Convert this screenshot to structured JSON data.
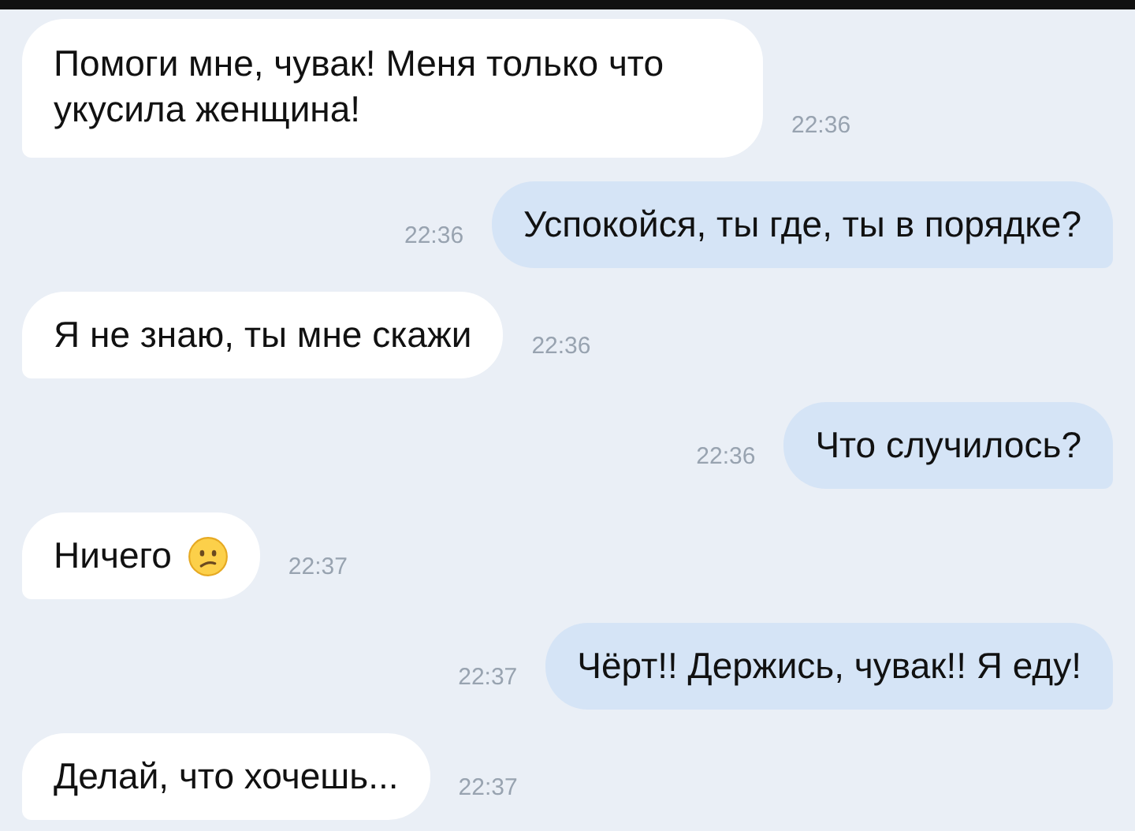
{
  "messages": [
    {
      "kind": "incoming",
      "text": "Помоги мне, чувак! Меня только что укусила женщина!",
      "time": "22:36"
    },
    {
      "kind": "outgoing",
      "text": "Успокойся, ты где, ты в порядке?",
      "time": "22:36"
    },
    {
      "kind": "incoming",
      "text": "Я не знаю, ты мне скажи",
      "time": "22:36"
    },
    {
      "kind": "outgoing",
      "text": "Что случилось?",
      "time": "22:36"
    },
    {
      "kind": "incoming",
      "text": "Ничего",
      "time": "22:37",
      "has_emoji": true
    },
    {
      "kind": "outgoing",
      "text": "Чёрт!! Держись, чувак!! Я еду!",
      "time": "22:37"
    },
    {
      "kind": "incoming",
      "text": "Делай, что хочешь...",
      "time": "22:37"
    }
  ]
}
